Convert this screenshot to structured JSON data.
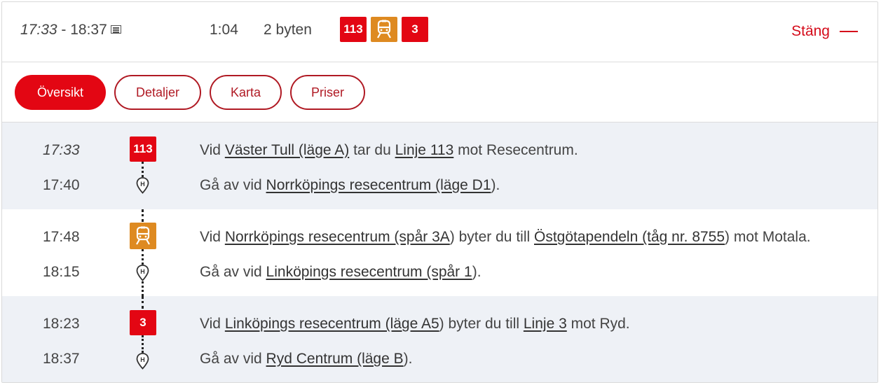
{
  "header": {
    "departure": "17:33",
    "separator": " - ",
    "arrival": "18:37",
    "duration": "1:04",
    "changes": "2 byten",
    "badges": [
      {
        "label": "113",
        "kind": "bus",
        "color": "#e30613"
      },
      {
        "label": "",
        "kind": "train",
        "icon": "train-icon",
        "color": "#de8a21"
      },
      {
        "label": "3",
        "kind": "bus",
        "color": "#e30613"
      }
    ],
    "close_label": "Stäng"
  },
  "tabs": [
    {
      "label": "Översikt",
      "active": true
    },
    {
      "label": "Detaljer",
      "active": false
    },
    {
      "label": "Karta",
      "active": false
    },
    {
      "label": "Priser",
      "active": false
    }
  ],
  "legs": [
    {
      "shaded": true,
      "badge": {
        "label": "113",
        "kind": "bus",
        "color": "#e30613"
      },
      "depart_time": "17:33",
      "depart_text": [
        "Vid ",
        {
          "link": "Väster Tull (läge A)"
        },
        " tar du ",
        {
          "link": "Linje 113"
        },
        " mot Resecentrum."
      ],
      "arrive_time": "17:40",
      "arrive_text": [
        "Gå av vid ",
        {
          "link": "Norrköpings resecentrum (läge D1"
        },
        ")."
      ]
    },
    {
      "shaded": false,
      "badge": {
        "label": "",
        "kind": "train",
        "icon": "train-icon",
        "color": "#de8a21"
      },
      "depart_time": "17:48",
      "depart_text": [
        "Vid ",
        {
          "link": "Norrköpings resecentrum (spår 3A"
        },
        ") byter du till ",
        {
          "link": "Östgötapendeln (tåg nr. 8755"
        },
        ") mot Motala."
      ],
      "arrive_time": "18:15",
      "arrive_text": [
        "Gå av vid ",
        {
          "link": "Linköpings resecentrum (spår 1"
        },
        ")."
      ]
    },
    {
      "shaded": true,
      "badge": {
        "label": "3",
        "kind": "bus",
        "color": "#e30613"
      },
      "depart_time": "18:23",
      "depart_text": [
        "Vid ",
        {
          "link": "Linköpings resecentrum (läge A5"
        },
        ") byter du till ",
        {
          "link": "Linje 3"
        },
        " mot Ryd."
      ],
      "arrive_time": "18:37",
      "arrive_text": [
        "Gå av vid ",
        {
          "link": "Ryd Centrum (läge B"
        },
        ")."
      ]
    }
  ]
}
